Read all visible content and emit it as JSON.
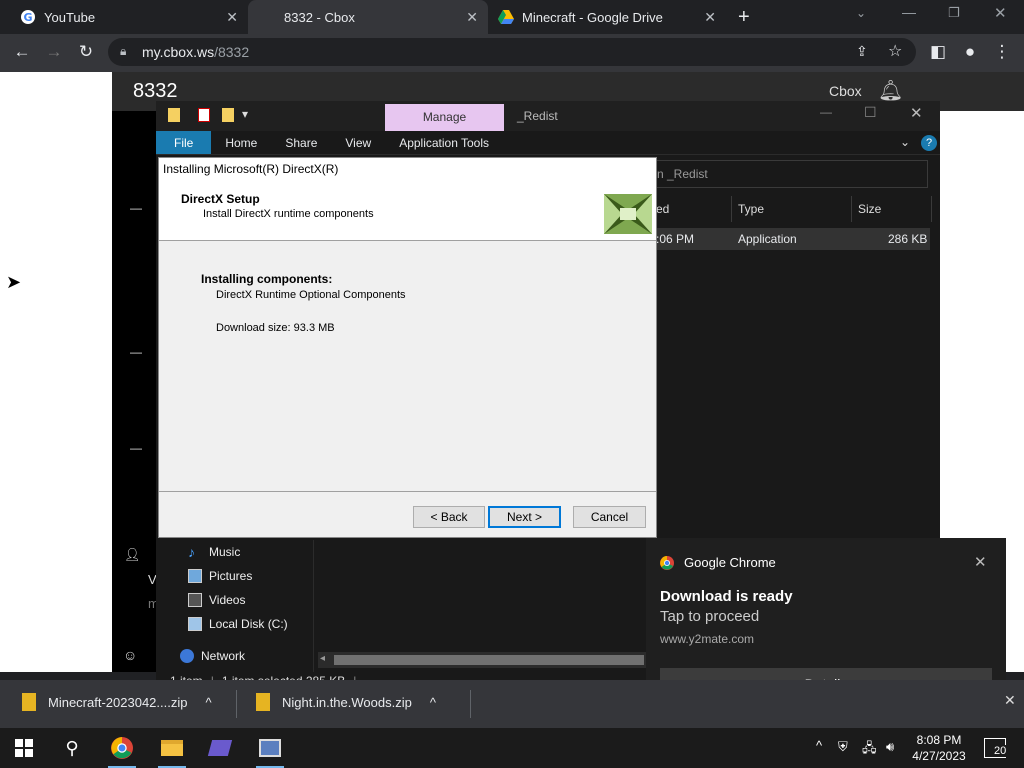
{
  "browser": {
    "tabs": [
      {
        "title": "YouTube",
        "icon": "google-icon"
      },
      {
        "title": "8332 - Cbox",
        "icon": "none"
      },
      {
        "title": "Minecraft - Google Drive",
        "icon": "google-drive-icon"
      }
    ],
    "url_domain": "my.cbox.ws",
    "url_path": "/8332"
  },
  "cbox": {
    "room": "8332",
    "brand": "Cbox",
    "partial_v": "V",
    "partial_m": "m"
  },
  "explorer": {
    "manage_tab": "Manage",
    "folder_title": "_Redist",
    "ribbon": [
      "File",
      "Home",
      "Share",
      "View",
      "Application Tools"
    ],
    "search_text": "n _Redist",
    "columns": [
      "ed",
      "Type",
      "Size"
    ],
    "file_row": {
      "modified": ":06 PM",
      "type": "Application",
      "size": "286 KB"
    },
    "nav": [
      "Music",
      "Pictures",
      "Videos",
      "Local Disk (C:)",
      "Network"
    ],
    "status": {
      "count": "1 item",
      "selected": "1 item selected  285 KB"
    }
  },
  "dialog": {
    "title": "Installing Microsoft(R) DirectX(R)",
    "heading": "DirectX Setup",
    "subheading": "Install DirectX runtime components",
    "installing_label": "Installing components:",
    "component": "DirectX Runtime Optional Components",
    "download_size": "Download size: 93.3 MB",
    "back": "< Back",
    "next": "Next >",
    "cancel": "Cancel"
  },
  "notification": {
    "app": "Google Chrome",
    "title": "Download is ready",
    "body": "Tap to proceed",
    "source": "www.y2mate.com",
    "action": "Details"
  },
  "downloads": [
    {
      "name": "Minecraft-2023042....zip"
    },
    {
      "name": "Night.in.the.Woods.zip"
    }
  ],
  "taskbar": {
    "time": "8:08 PM",
    "date": "4/27/2023",
    "notif_count": "20"
  }
}
